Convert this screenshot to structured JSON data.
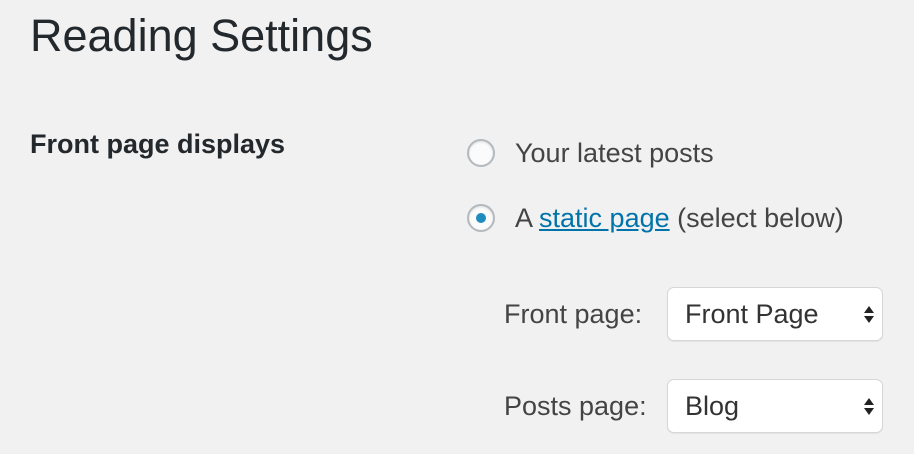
{
  "page": {
    "title": "Reading Settings"
  },
  "front_page_displays": {
    "label": "Front page displays",
    "options": [
      {
        "label": "Your latest posts",
        "checked": false
      },
      {
        "prefix": "A ",
        "link_text": "static page",
        "suffix": " (select below)",
        "checked": true
      }
    ],
    "front_page": {
      "label": "Front page:",
      "value": "Front Page"
    },
    "posts_page": {
      "label": "Posts page:",
      "value": "Blog"
    }
  },
  "colors": {
    "background": "#f1f1f1",
    "link": "#0073aa",
    "radio_checked": "#1e8cbe"
  },
  "icons": {
    "select_arrows": "up-down-chevron-icon"
  }
}
